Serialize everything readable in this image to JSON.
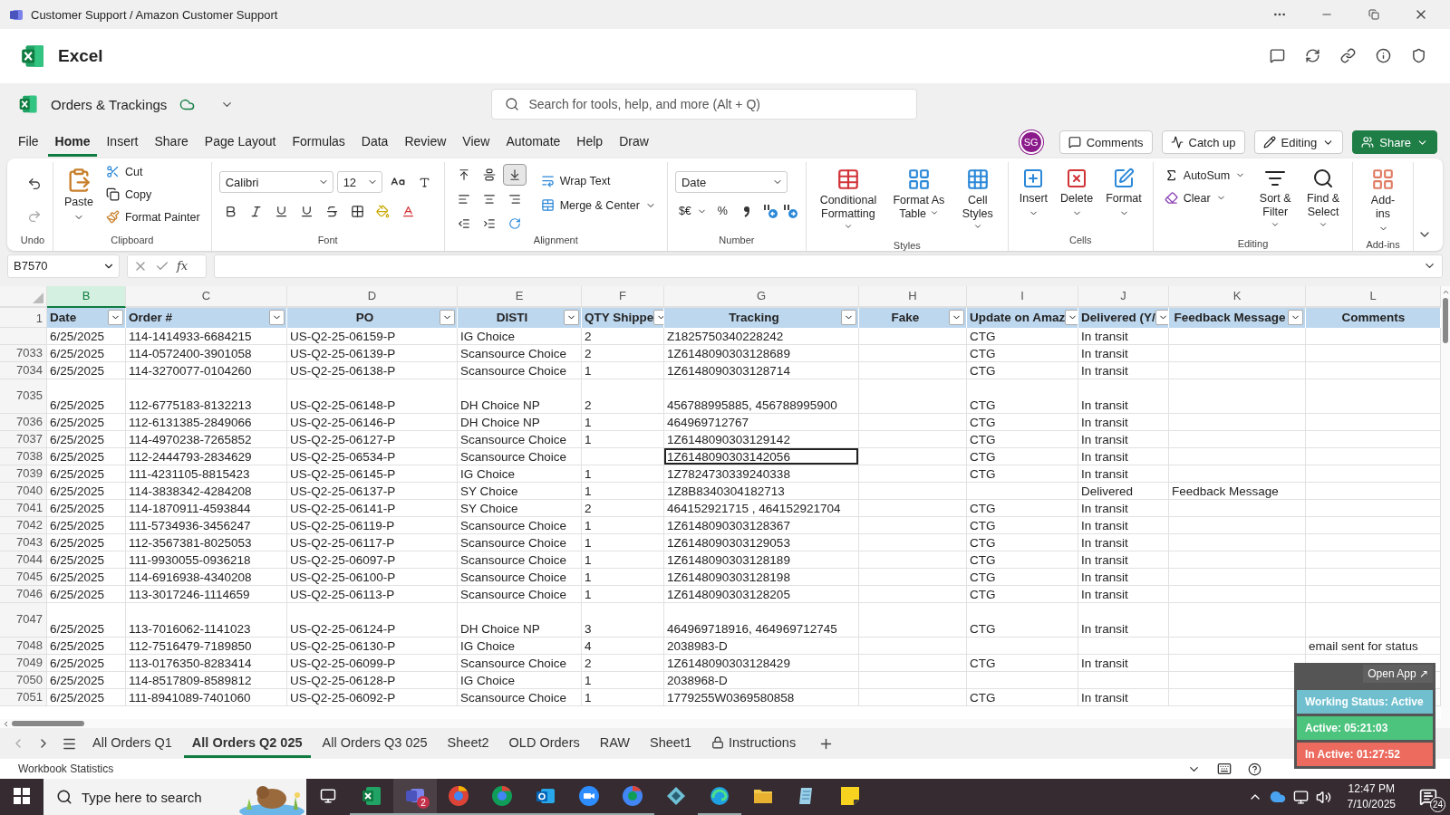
{
  "window": {
    "title": "Customer Support / Amazon Customer Support"
  },
  "app": {
    "name": "Excel"
  },
  "document": {
    "title": "Orders & Trackings",
    "search_placeholder": "Search for tools, help, and more (Alt + Q)"
  },
  "menu": [
    {
      "label": "File",
      "selected": false
    },
    {
      "label": "Home",
      "selected": true
    },
    {
      "label": "Insert",
      "selected": false
    },
    {
      "label": "Share",
      "selected": false
    },
    {
      "label": "Page Layout",
      "selected": false
    },
    {
      "label": "Formulas",
      "selected": false
    },
    {
      "label": "Data",
      "selected": false
    },
    {
      "label": "Review",
      "selected": false
    },
    {
      "label": "View",
      "selected": false
    },
    {
      "label": "Automate",
      "selected": false
    },
    {
      "label": "Help",
      "selected": false
    },
    {
      "label": "Draw",
      "selected": false
    }
  ],
  "account": {
    "initials": "SG",
    "comments": "Comments",
    "catch_up": "Catch up",
    "mode": "Editing",
    "share": "Share"
  },
  "ribbon": {
    "undo": {
      "label": "Undo"
    },
    "clipboard": {
      "paste": "Paste",
      "cut": "Cut",
      "copy": "Copy",
      "format_painter": "Format Painter",
      "label": "Clipboard"
    },
    "font": {
      "name": "Calibri",
      "size": "12",
      "label": "Font"
    },
    "alignment": {
      "vertical": [
        {
          "selected": false
        },
        {
          "selected": false
        },
        {
          "selected": true
        }
      ],
      "wrap": "Wrap Text",
      "merge": "Merge & Center",
      "label": "Alignment"
    },
    "number": {
      "format": "Date",
      "currency": "$€",
      "percent": "%",
      "label": "Number"
    },
    "styles": {
      "buttons": [
        "Conditional Formatting",
        "Format As Table",
        "Cell Styles"
      ],
      "label": "Styles"
    },
    "cells": {
      "buttons": [
        "Insert",
        "Delete",
        "Format"
      ],
      "label": "Cells"
    },
    "editing": {
      "autosum": "AutoSum",
      "clear": "Clear",
      "buttons": [
        "Sort & Filter",
        "Find & Select"
      ],
      "label": "Editing"
    },
    "addins": {
      "button": "Add-ins",
      "label": "Add-ins"
    }
  },
  "formula_bar": {
    "cell": "B7570",
    "fx": "fx"
  },
  "columns": [
    {
      "letter": "B",
      "selected": true
    },
    {
      "letter": "C",
      "selected": false
    },
    {
      "letter": "D",
      "selected": false
    },
    {
      "letter": "E",
      "selected": false
    },
    {
      "letter": "F",
      "selected": false
    },
    {
      "letter": "G",
      "selected": false
    },
    {
      "letter": "H",
      "selected": false
    },
    {
      "letter": "I",
      "selected": false
    },
    {
      "letter": "J",
      "selected": false
    },
    {
      "letter": "K",
      "selected": false
    },
    {
      "letter": "L",
      "selected": false
    }
  ],
  "header_row": {
    "number": "1",
    "cells": [
      {
        "text": "Date",
        "filter": true
      },
      {
        "text": "Order #",
        "filter": true
      },
      {
        "text": "PO",
        "filter": true
      },
      {
        "text": "DISTI",
        "filter": true
      },
      {
        "text": "QTY Shippe",
        "filter": true
      },
      {
        "text": "Tracking",
        "filter": true
      },
      {
        "text": "Fake",
        "filter": true
      },
      {
        "text": "Update on Amaz",
        "filter": true
      },
      {
        "text": "Delivered (Y/",
        "filter": true
      },
      {
        "text": "Feedback Message",
        "filter": true
      },
      {
        "text": "Comments",
        "filter": false
      }
    ]
  },
  "rows": [
    {
      "tall": false,
      "selected": false,
      "date": "6/25/2025",
      "order": "114-1414933-6684215",
      "po": "US-Q2-25-06159-P",
      "disti": "IG Choice",
      "qty": "2",
      "tracking": "Z1825750340228242",
      "update": "CTG",
      "delivered": "In transit"
    },
    {
      "number": "7033",
      "tall": false,
      "selected": false,
      "date": "6/25/2025",
      "order": "114-0572400-3901058",
      "po": "US-Q2-25-06139-P",
      "disti": "Scansource Choice",
      "qty": "2",
      "tracking": "1Z6148090303128689",
      "update": "CTG",
      "delivered": "In transit"
    },
    {
      "number": "7034",
      "tall": false,
      "selected": false,
      "date": "6/25/2025",
      "order": "114-3270077-0104260",
      "po": "US-Q2-25-06138-P",
      "disti": "Scansource Choice",
      "qty": "1",
      "tracking": "1Z6148090303128714",
      "update": "CTG",
      "delivered": "In transit"
    },
    {
      "number": "7035",
      "tall": true,
      "selected": false,
      "date": "6/25/2025",
      "order": "112-6775183-8132213",
      "po": "US-Q2-25-06148-P",
      "disti": "DH Choice NP",
      "qty": "2",
      "tracking": "456788995885, 456788995900",
      "update": "CTG",
      "delivered": "In transit"
    },
    {
      "number": "7036",
      "tall": false,
      "selected": false,
      "date": "6/25/2025",
      "order": "112-6131385-2849066",
      "po": "US-Q2-25-06146-P",
      "disti": "DH Choice NP",
      "qty": "1",
      "tracking": "464969712767",
      "update": "CTG",
      "delivered": "In transit"
    },
    {
      "number": "7037",
      "tall": false,
      "selected": false,
      "date": "6/25/2025",
      "order": "114-4970238-7265852",
      "po": "US-Q2-25-06127-P",
      "disti": "Scansource Choice",
      "qty": "1",
      "tracking": "1Z6148090303129142",
      "update": "CTG",
      "delivered": "In transit"
    },
    {
      "number": "7038",
      "tall": false,
      "selected": true,
      "date": "6/25/2025",
      "order": "112-2444793-2834629",
      "po": "US-Q2-25-06534-P",
      "disti": "Scansource Choice",
      "tracking": "1Z6148090303142056",
      "update": "CTG",
      "delivered": "In transit"
    },
    {
      "number": "7039",
      "tall": false,
      "selected": false,
      "date": "6/25/2025",
      "order": "111-4231105-8815423",
      "po": "US-Q2-25-06145-P",
      "disti": "IG Choice",
      "qty": "1",
      "tracking": "1Z7824730339240338",
      "update": "CTG",
      "delivered": "In transit"
    },
    {
      "number": "7040",
      "tall": false,
      "selected": false,
      "date": "6/25/2025",
      "order": "114-3838342-4284208",
      "po": "US-Q2-25-06137-P",
      "disti": "SY Choice",
      "qty": "1",
      "tracking": "1Z8B8340304182713",
      "delivered": "Delivered",
      "feedback": "Feedback Message"
    },
    {
      "number": "7041",
      "tall": false,
      "selected": false,
      "date": "6/25/2025",
      "order": "114-1870911-4593844",
      "po": "US-Q2-25-06141-P",
      "disti": "SY Choice",
      "qty": "2",
      "tracking": "464152921715 , 464152921704",
      "update": "CTG",
      "delivered": "In transit"
    },
    {
      "number": "7042",
      "tall": false,
      "selected": false,
      "date": "6/25/2025",
      "order": "111-5734936-3456247",
      "po": "US-Q2-25-06119-P",
      "disti": "Scansource Choice",
      "qty": "1",
      "tracking": "1Z6148090303128367",
      "update": "CTG",
      "delivered": "In transit"
    },
    {
      "number": "7043",
      "tall": false,
      "selected": false,
      "date": "6/25/2025",
      "order": "112-3567381-8025053",
      "po": "US-Q2-25-06117-P",
      "disti": "Scansource Choice",
      "qty": "1",
      "tracking": "1Z6148090303129053",
      "update": "CTG",
      "delivered": "In transit"
    },
    {
      "number": "7044",
      "tall": false,
      "selected": false,
      "date": "6/25/2025",
      "order": "111-9930055-0936218",
      "po": "US-Q2-25-06097-P",
      "disti": "Scansource Choice",
      "qty": "1",
      "tracking": "1Z6148090303128189",
      "update": "CTG",
      "delivered": "In transit"
    },
    {
      "number": "7045",
      "tall": false,
      "selected": false,
      "date": "6/25/2025",
      "order": "114-6916938-4340208",
      "po": "US-Q2-25-06100-P",
      "disti": "Scansource Choice",
      "qty": "1",
      "tracking": "1Z6148090303128198",
      "update": "CTG",
      "delivered": "In transit"
    },
    {
      "number": "7046",
      "tall": false,
      "selected": false,
      "date": "6/25/2025",
      "order": "113-3017246-1114659",
      "po": "US-Q2-25-06113-P",
      "disti": "Scansource Choice",
      "qty": "1",
      "tracking": "1Z6148090303128205",
      "update": "CTG",
      "delivered": "In transit"
    },
    {
      "number": "7047",
      "tall": true,
      "selected": false,
      "date": "6/25/2025",
      "order": "113-7016062-1141023",
      "po": "US-Q2-25-06124-P",
      "disti": "DH Choice NP",
      "qty": "3",
      "tracking": "464969718916, 464969712745",
      "update": "CTG",
      "delivered": "In transit"
    },
    {
      "number": "7048",
      "tall": false,
      "selected": false,
      "date": "6/25/2025",
      "order": "112-7516479-7189850",
      "po": "US-Q2-25-06130-P",
      "disti": "IG Choice",
      "qty": "4",
      "tracking": "2038983-D",
      "comments": "email sent for status"
    },
    {
      "number": "7049",
      "tall": false,
      "selected": false,
      "date": "6/25/2025",
      "order": "113-0176350-8283414",
      "po": "US-Q2-25-06099-P",
      "disti": "Scansource Choice",
      "qty": "2",
      "tracking": "1Z6148090303128429",
      "update": "CTG",
      "delivered": "In transit"
    },
    {
      "number": "7050",
      "tall": false,
      "selected": false,
      "date": "6/25/2025",
      "order": "114-8517809-8589812",
      "po": "US-Q2-25-06128-P",
      "disti": "IG Choice",
      "qty": "1",
      "tracking": "2038968-D"
    },
    {
      "number": "7051",
      "tall": false,
      "selected": false,
      "date": "6/25/2025",
      "order": "111-8941089-7401060",
      "po": "US-Q2-25-06092-P",
      "disti": "Scansource Choice",
      "qty": "1",
      "tracking": "1779255W0369580858",
      "update": "CTG",
      "delivered": "In transit"
    }
  ],
  "sheets": [
    {
      "label": "All Orders Q1",
      "selected": false,
      "locked": false
    },
    {
      "label": "All Orders Q2 025",
      "selected": true,
      "locked": false
    },
    {
      "label": "All Orders Q3 025",
      "selected": false,
      "locked": false
    },
    {
      "label": "Sheet2",
      "selected": false,
      "locked": false
    },
    {
      "label": "OLD Orders",
      "selected": false,
      "locked": false
    },
    {
      "label": "RAW",
      "selected": false,
      "locked": false
    },
    {
      "label": "Sheet1",
      "selected": false,
      "locked": false
    },
    {
      "label": "Instructions",
      "selected": false,
      "locked": true
    }
  ],
  "status_bar": {
    "text": "Workbook Statistics"
  },
  "tracker": {
    "open": "Open App ↗",
    "statuses": [
      {
        "text": "Working Status: Active",
        "color": "#6fbfcf"
      },
      {
        "text": "Active: 05:21:03",
        "color": "#4cc47e"
      },
      {
        "text": "In Active: 01:27:52",
        "color": "#ec6a5e"
      }
    ]
  },
  "taskbar": {
    "search_placeholder": "Type here to search",
    "teams_badge": "2",
    "time": "12:47 PM",
    "date": "7/10/2025",
    "notifications": "24"
  }
}
